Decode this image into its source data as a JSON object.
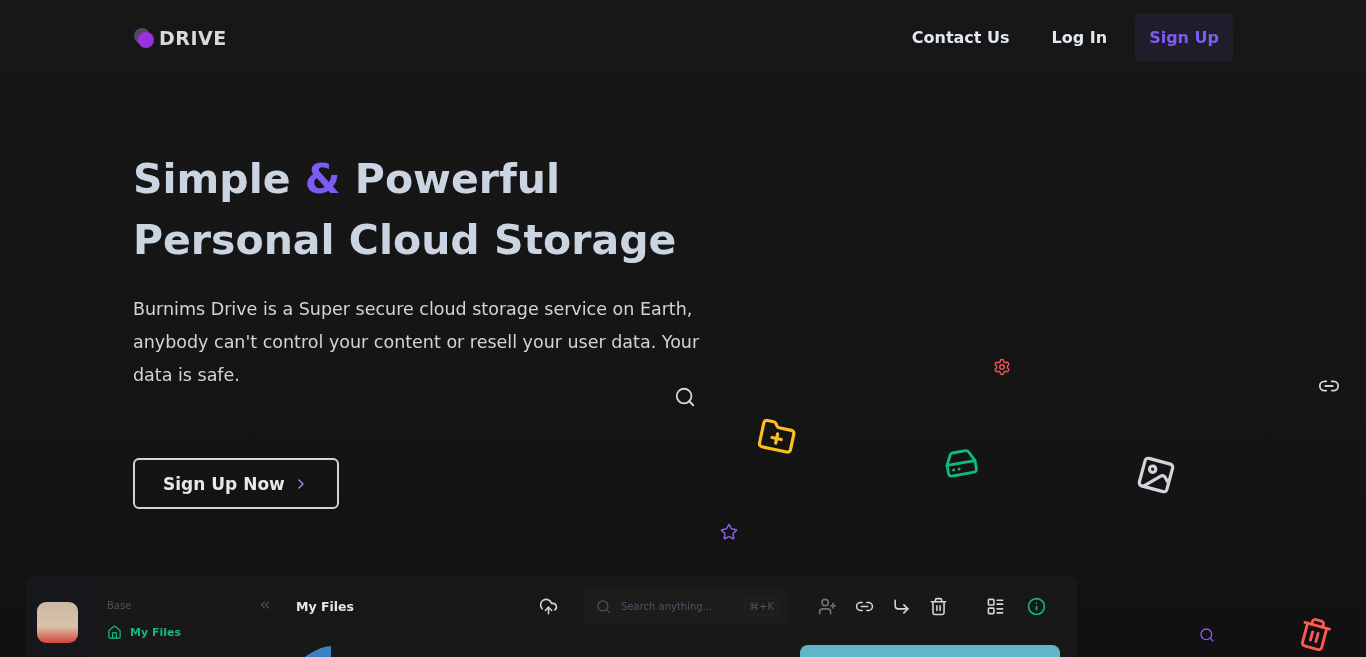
{
  "brand": {
    "name": "DRIVE"
  },
  "nav": [
    {
      "label": "Contact Us",
      "kind": "link"
    },
    {
      "label": "Log In",
      "kind": "link"
    },
    {
      "label": "Sign Up",
      "kind": "button"
    }
  ],
  "hero": {
    "title_lines": [
      [
        {
          "text": "Simple ",
          "accent": false
        },
        {
          "text": "&",
          "accent": true
        },
        {
          "text": " Powerful",
          "accent": false
        }
      ],
      [
        {
          "text": "Personal Cloud Storage",
          "accent": false
        }
      ]
    ],
    "description": "Burnims Drive is a Super secure cloud storage service on Earth, anybody can't control your content or resell your user data. Your data is safe.",
    "cta": "Sign Up Now"
  },
  "floating_icons": [
    {
      "kind": "search",
      "color": "#d1d5db"
    },
    {
      "kind": "folder-plus",
      "color": "#fbbf24"
    },
    {
      "kind": "gear",
      "color": "#ef5350"
    },
    {
      "kind": "drive",
      "color": "#10b981"
    },
    {
      "kind": "image",
      "color": "#d1d5db"
    },
    {
      "kind": "link",
      "color": "#d1d5db"
    },
    {
      "kind": "star",
      "color": "#8b5cf6"
    },
    {
      "kind": "search",
      "color": "#8b5cf6"
    },
    {
      "kind": "trash",
      "color": "#ff5a4f"
    }
  ],
  "preview": {
    "sidebar": {
      "section": "Base",
      "items": [
        {
          "label": "My Files",
          "selected": true
        }
      ]
    },
    "header": {
      "title": "My Files",
      "search": {
        "placeholder": "Search anything...",
        "shortcut": "⌘+K"
      }
    }
  }
}
